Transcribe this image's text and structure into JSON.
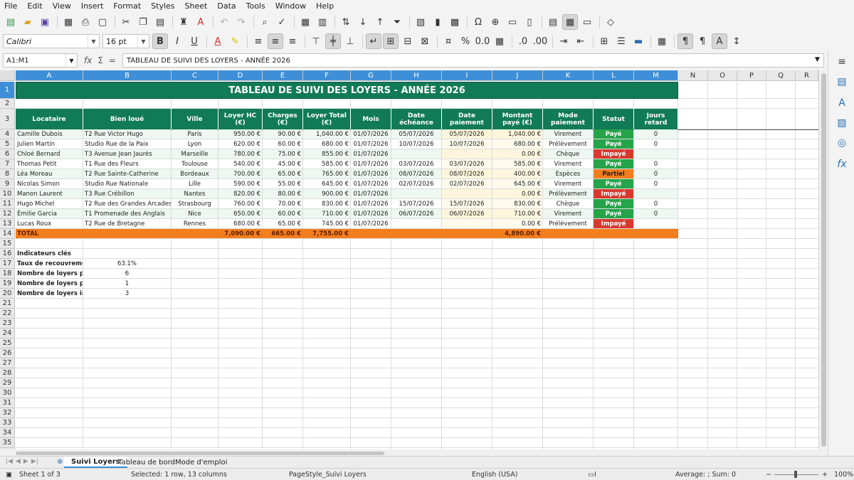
{
  "menu": [
    "File",
    "Edit",
    "View",
    "Insert",
    "Format",
    "Styles",
    "Sheet",
    "Data",
    "Tools",
    "Window",
    "Help"
  ],
  "font": {
    "name": "Calibri",
    "size": "16 pt"
  },
  "formula": {
    "namebox": "A1:M1",
    "content": "TABLEAU DE SUIVI DES LOYERS - ANNÉE 2026"
  },
  "columns": [
    "A",
    "B",
    "C",
    "D",
    "E",
    "F",
    "G",
    "H",
    "I",
    "J",
    "K",
    "L",
    "M",
    "N",
    "O",
    "P",
    "Q",
    "R"
  ],
  "sheet": {
    "title": "TABLEAU DE SUIVI DES LOYERS - ANNÉE 2026",
    "headers": [
      "Locataire",
      "Bien loué",
      "Ville",
      "Loyer HC (€)",
      "Charges (€)",
      "Loyer Total (€)",
      "Mois",
      "Date échéance",
      "Date paiement",
      "Montant payé (€)",
      "Mode paiement",
      "Statut",
      "Jours retard"
    ],
    "rows": [
      [
        "Camille Dubois",
        "T2 Rue Victor Hugo",
        "Paris",
        "950.00 €",
        "90.00 €",
        "1,040.00 €",
        "01/07/2026",
        "05/07/2026",
        "05/07/2026",
        "1,040.00 €",
        "Virement",
        "Payé",
        "0"
      ],
      [
        "Julien Martin",
        "Studio Rue de la Paix",
        "Lyon",
        "620.00 €",
        "60.00 €",
        "680.00 €",
        "01/07/2026",
        "10/07/2026",
        "10/07/2026",
        "680.00 €",
        "Prélèvement",
        "Payé",
        "0"
      ],
      [
        "Chloé Bernard",
        "T3 Avenue Jean Jaurès",
        "Marseille",
        "780.00 €",
        "75.00 €",
        "855.00 €",
        "01/07/2026",
        "",
        "",
        "0.00 €",
        "Chèque",
        "Impayé",
        ""
      ],
      [
        "Thomas Petit",
        "T1 Rue des Fleurs",
        "Toulouse",
        "540.00 €",
        "45.00 €",
        "585.00 €",
        "01/07/2026",
        "03/07/2026",
        "03/07/2026",
        "585.00 €",
        "Virement",
        "Payé",
        "0"
      ],
      [
        "Léa Moreau",
        "T2 Rue Sainte-Catherine",
        "Bordeaux",
        "700.00 €",
        "65.00 €",
        "765.00 €",
        "01/07/2026",
        "08/07/2026",
        "08/07/2026",
        "400.00 €",
        "Espèces",
        "Partiel",
        "0"
      ],
      [
        "Nicolas Simon",
        "Studio Rue Nationale",
        "Lille",
        "590.00 €",
        "55.00 €",
        "645.00 €",
        "01/07/2026",
        "02/07/2026",
        "02/07/2026",
        "645.00 €",
        "Virement",
        "Payé",
        "0"
      ],
      [
        "Manon Laurent",
        "T3 Rue Crébillon",
        "Nantes",
        "820.00 €",
        "80.00 €",
        "900.00 €",
        "01/07/2026",
        "",
        "",
        "0.00 €",
        "Prélèvement",
        "Impayé",
        ""
      ],
      [
        "Hugo Michel",
        "T2 Rue des Grandes Arcades",
        "Strasbourg",
        "760.00 €",
        "70.00 €",
        "830.00 €",
        "01/07/2026",
        "15/07/2026",
        "15/07/2026",
        "830.00 €",
        "Chèque",
        "Payé",
        "0"
      ],
      [
        "Émilie Garcia",
        "T1 Promenade des Anglais",
        "Nice",
        "650.00 €",
        "60.00 €",
        "710.00 €",
        "01/07/2026",
        "06/07/2026",
        "06/07/2026",
        "710.00 €",
        "Virement",
        "Payé",
        "0"
      ],
      [
        "Lucas Roux",
        "T2 Rue de Bretagne",
        "Rennes",
        "680.00 €",
        "65.00 €",
        "745.00 €",
        "01/07/2026",
        "",
        "",
        "0.00 €",
        "Prélèvement",
        "Impayé",
        ""
      ]
    ],
    "total": {
      "label": "TOTAL",
      "loyer_hc": "7,090.00 €",
      "charges": "665.00 €",
      "loyer_total": "7,755.00 €",
      "montant_paye": "4,890.00 €"
    },
    "indicators": {
      "title": "Indicateurs clés",
      "items": [
        {
          "label": "Taux de recouvrement",
          "value": "63.1%"
        },
        {
          "label": "Nombre de loyers payés",
          "value": "6"
        },
        {
          "label": "Nombre de loyers partiels",
          "value": "1"
        },
        {
          "label": "Nombre de loyers impayés",
          "value": "3"
        }
      ]
    }
  },
  "tabs": [
    "Suivi Loyers",
    "Tableau de bord",
    "Mode d'emploi"
  ],
  "status": {
    "sheet": "Sheet 1 of 3",
    "selection": "Selected: 1 row, 13 columns",
    "pagestyle": "PageStyle_Suivi Loyers",
    "language": "English (USA)",
    "sum": "Average: ; Sum: 0",
    "zoom": "100%"
  },
  "colors": {
    "green": "#117a56",
    "paid": "#27a34a",
    "unpaid": "#d63a2f",
    "partial": "#f37e1d",
    "select": "#3e8fd8"
  }
}
